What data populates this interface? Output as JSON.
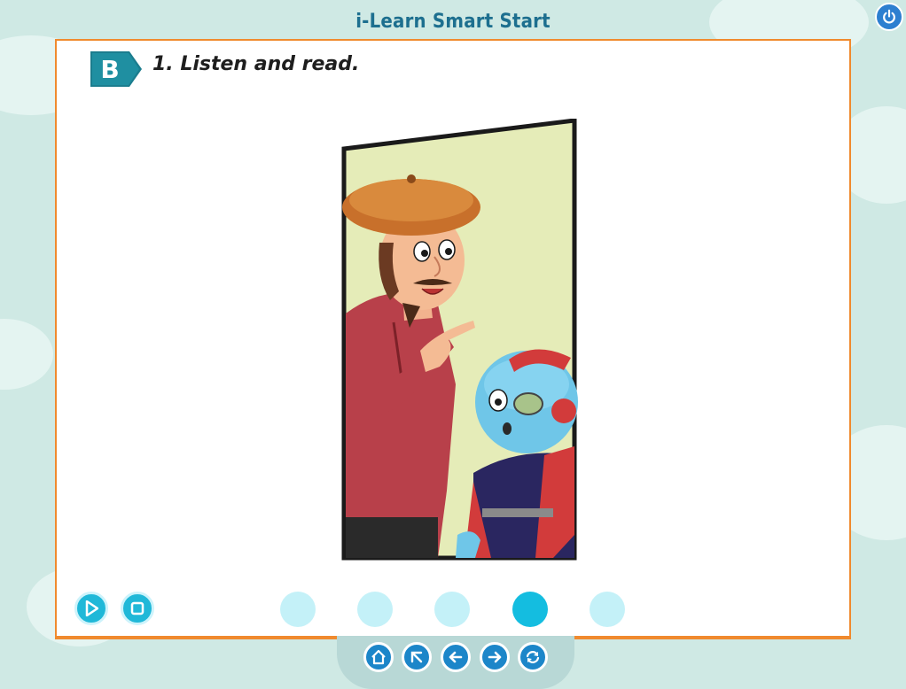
{
  "app": {
    "title": "i-Learn Smart Start"
  },
  "section": {
    "badge": "B",
    "instruction": "1. Listen and read."
  },
  "controls": {
    "play_icon": "play-icon",
    "stop_icon": "stop-icon"
  },
  "pagination": {
    "count": 5,
    "active_index": 3
  },
  "nav": {
    "buttons": [
      "home-icon",
      "expand-icon",
      "back-arrow-icon",
      "forward-arrow-icon",
      "refresh-icon"
    ]
  },
  "colors": {
    "accent": "#1c86c9",
    "border": "#f08a2e",
    "badge": "#1b7d8e",
    "dot_active": "#14bde0",
    "dot_inactive": "#c4f1f8"
  }
}
